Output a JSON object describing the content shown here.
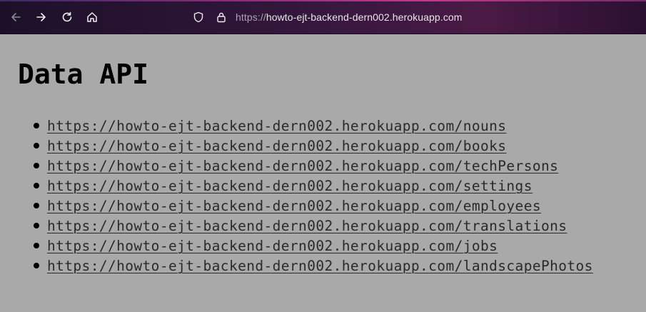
{
  "browser": {
    "url_scheme": "https://",
    "url_host": "howto-ejt-backend-dern002.herokuapp.com",
    "icons": [
      "back-arrow-icon",
      "forward-arrow-icon",
      "reload-icon",
      "home-icon",
      "shield-icon",
      "lock-icon"
    ]
  },
  "page": {
    "title": "Data API",
    "links": [
      {
        "text": "https://howto-ejt-backend-dern002.herokuapp.com/nouns"
      },
      {
        "text": "https://howto-ejt-backend-dern002.herokuapp.com/books"
      },
      {
        "text": "https://howto-ejt-backend-dern002.herokuapp.com/techPersons"
      },
      {
        "text": "https://howto-ejt-backend-dern002.herokuapp.com/settings"
      },
      {
        "text": "https://howto-ejt-backend-dern002.herokuapp.com/employees"
      },
      {
        "text": "https://howto-ejt-backend-dern002.herokuapp.com/translations"
      },
      {
        "text": "https://howto-ejt-backend-dern002.herokuapp.com/jobs"
      },
      {
        "text": "https://howto-ejt-backend-dern002.herokuapp.com/landscapePhotos"
      }
    ]
  },
  "colors": {
    "page_background": "#a9a9a9",
    "link": "#2a2a2a",
    "heading": "#000000"
  }
}
